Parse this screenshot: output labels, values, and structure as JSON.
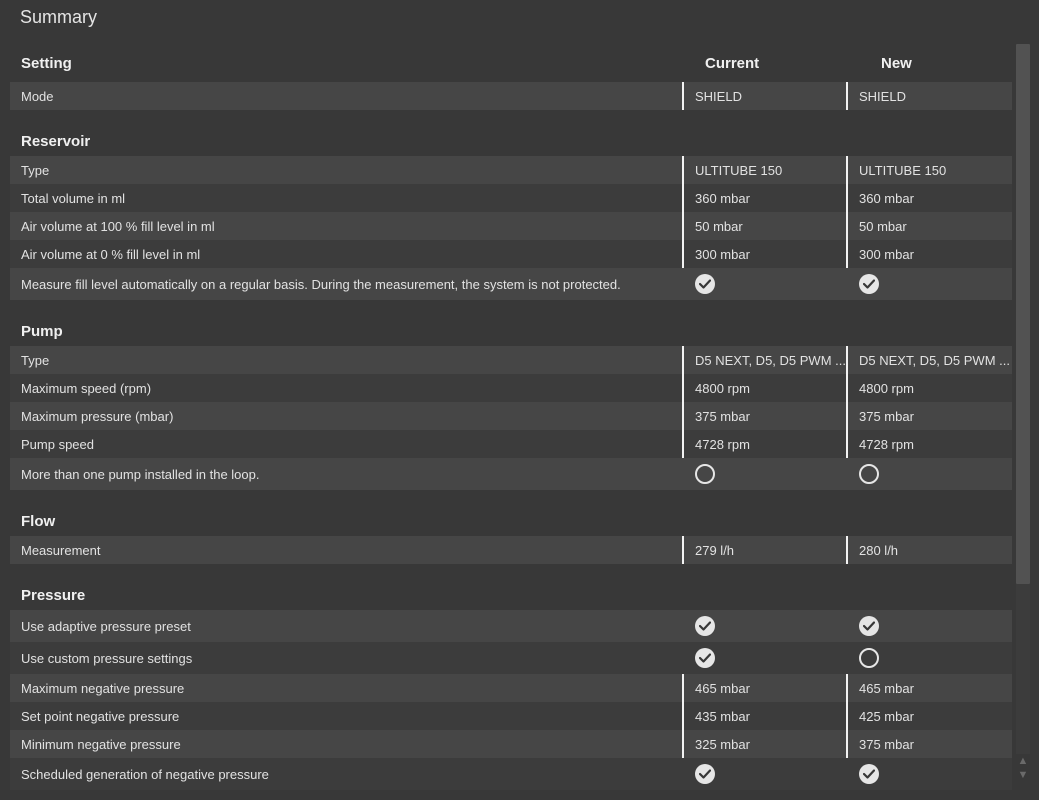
{
  "title": "Summary",
  "headers": {
    "setting": "Setting",
    "current": "Current",
    "new": "New"
  },
  "mode_row": {
    "label": "Mode",
    "current": "SHIELD",
    "new": "SHIELD"
  },
  "sections": [
    {
      "title": "Reservoir",
      "rows": [
        {
          "label": "Type",
          "current": "ULTITUBE 150",
          "new": "ULTITUBE 150"
        },
        {
          "label": "Total volume in ml",
          "current": "360 mbar",
          "new": "360 mbar"
        },
        {
          "label": "Air volume at 100 % fill level in ml",
          "current": "50 mbar",
          "new": "50 mbar"
        },
        {
          "label": "Air volume at 0 % fill level in ml",
          "current": "300 mbar",
          "new": "300 mbar"
        },
        {
          "label": "Measure fill level automatically on a regular basis. During the measurement, the system is not protected.",
          "current": "check-icon",
          "new": "check-icon"
        }
      ]
    },
    {
      "title": "Pump",
      "rows": [
        {
          "label": "Type",
          "current": "D5 NEXT, D5, D5 PWM ...",
          "new": "D5 NEXT, D5, D5 PWM ..."
        },
        {
          "label": "Maximum speed (rpm)",
          "current": "4800 rpm",
          "new": "4800 rpm"
        },
        {
          "label": "Maximum pressure (mbar)",
          "current": "375 mbar",
          "new": "375 mbar"
        },
        {
          "label": "Pump speed",
          "current": "4728 rpm",
          "new": "4728 rpm"
        },
        {
          "label": "More than one pump installed in the loop.",
          "current": "circle-icon",
          "new": "circle-icon"
        }
      ]
    },
    {
      "title": "Flow",
      "rows": [
        {
          "label": "Measurement",
          "current": "279 l/h",
          "new": "280 l/h"
        }
      ]
    },
    {
      "title": "Pressure",
      "rows": [
        {
          "label": "Use adaptive pressure preset",
          "current": "check-icon",
          "new": "check-icon"
        },
        {
          "label": "Use custom pressure settings",
          "current": "check-icon",
          "new": "circle-icon"
        },
        {
          "label": "Maximum negative pressure",
          "current": "465 mbar",
          "new": "465 mbar"
        },
        {
          "label": "Set point negative pressure",
          "current": "435 mbar",
          "new": "425 mbar"
        },
        {
          "label": "Minimum negative pressure",
          "current": "325 mbar",
          "new": "375 mbar"
        },
        {
          "label": "Scheduled generation of negative pressure",
          "current": "check-icon",
          "new": "check-icon"
        }
      ]
    }
  ],
  "colors": {
    "background": "#383838",
    "row_light": "#464646",
    "row_dark": "#3c3c3c",
    "text": "#e6e6e6"
  }
}
